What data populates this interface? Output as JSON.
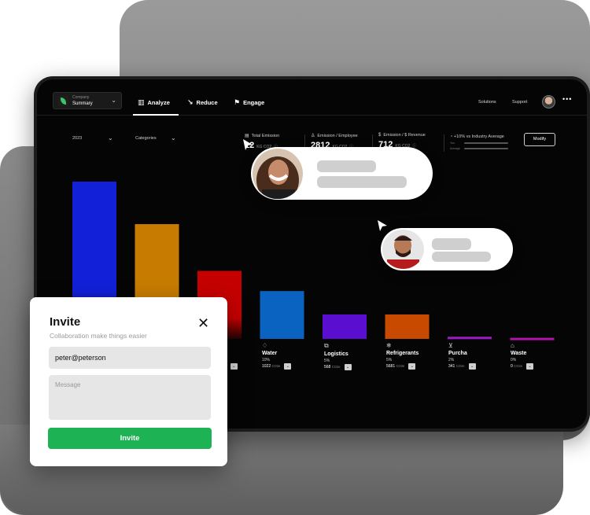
{
  "header": {
    "company_label": "Company",
    "company_value": "Summary",
    "nav": [
      {
        "label": "Analyze",
        "icon": "bar-chart-icon",
        "active": true
      },
      {
        "label": "Reduce",
        "icon": "arrow-down-right-icon"
      },
      {
        "label": "Engage",
        "icon": "flag-icon"
      }
    ],
    "links": [
      "Solutions",
      "Support"
    ],
    "more": "•••"
  },
  "filters": {
    "year": "2023",
    "category": "Categories"
  },
  "metrics": [
    {
      "label": "Total Emission",
      "value": "12",
      "unit": "KG CO2"
    },
    {
      "label": "Emission / Employee",
      "value": "2812",
      "unit": "KG CO2"
    },
    {
      "label": "Emission / $ Revenue",
      "value": "712",
      "unit": "KG CO2"
    }
  ],
  "industry": {
    "label": "+10% vs Industry Average",
    "row1": "You",
    "row2": "Average"
  },
  "modify_label": "Modify",
  "chart_data": {
    "type": "bar",
    "title": "",
    "categories": [
      "",
      "",
      "",
      "Water",
      "Logistics",
      "Refrigerants",
      "Purcha",
      "Waste"
    ],
    "values": [
      148,
      108,
      64,
      45,
      23,
      23,
      2,
      1
    ],
    "colors": [
      "#1220d8",
      "#c77b00",
      "#c50000",
      "#0a63c0",
      "#5a0fd0",
      "#c84a00",
      "#9b1bc8",
      "#b112a8"
    ],
    "details": [
      {
        "name": "Water",
        "pct": "10%",
        "value": "1022",
        "unit": "CO2e",
        "icon": "water-drop-icon"
      },
      {
        "name": "Logistics",
        "pct": "5%",
        "value": "568",
        "unit": "CO2e",
        "icon": "box-icon"
      },
      {
        "name": "Refrigerants",
        "pct": "5%",
        "value": "5681",
        "unit": "CO2e",
        "icon": "snowflake-icon"
      },
      {
        "name": "Purcha",
        "pct": "2%",
        "value": "341",
        "unit": "CO2e",
        "icon": "cart-icon"
      },
      {
        "name": "Waste",
        "pct": "0%",
        "value": "0",
        "unit": "CO2e",
        "icon": "trash-icon"
      }
    ],
    "partial_label": "CO2e"
  },
  "invite": {
    "title": "Invite",
    "subtitle": "Collaboration make things easier",
    "email_value": "peter@peterson",
    "message_placeholder": "Message",
    "button_label": "Invite"
  }
}
